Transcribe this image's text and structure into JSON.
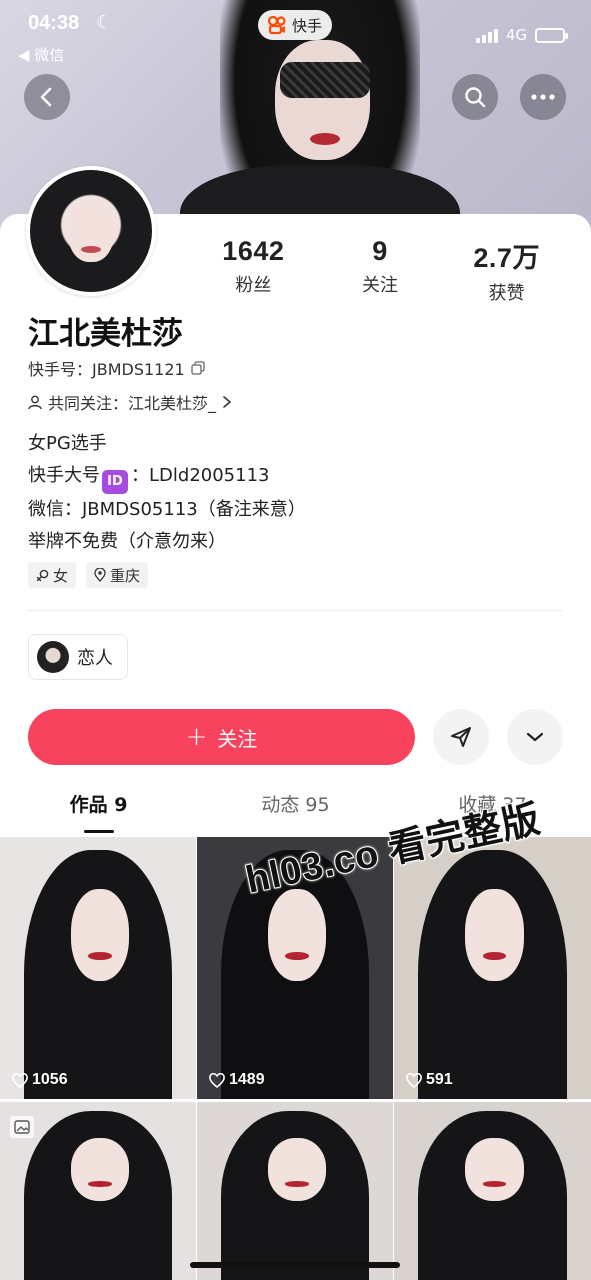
{
  "status_bar": {
    "time": "04:38",
    "back_app": "◀ 微信",
    "app_name": "快手",
    "network": "4G"
  },
  "profile": {
    "stats": [
      {
        "value": "1642",
        "label": "粉丝"
      },
      {
        "value": "9",
        "label": "关注"
      },
      {
        "value": "2.7万",
        "label": "获赞"
      }
    ],
    "name": "江北美杜莎",
    "kuaishou_id": "快手号：JBMDS1121",
    "mutual": "共同关注：江北美杜莎_",
    "bio": {
      "line1": "女PG选手",
      "line2_prefix": "快手大号",
      "line2_badge": "ID",
      "line2_suffix": "：LDld2005113",
      "line3": "微信：JBMDS05113（备注来意）",
      "line4": "举牌不免费（介意勿来）"
    },
    "tags": [
      {
        "icon": "female-icon",
        "label": "女"
      },
      {
        "icon": "location-pin-icon",
        "label": "重庆"
      }
    ],
    "relation_label": "恋人"
  },
  "actions": {
    "follow_label": "关注",
    "accent_color": "#f8435f"
  },
  "tabs": [
    {
      "label": "作品 9",
      "active": true
    },
    {
      "label": "动态 95",
      "active": false
    },
    {
      "label": "收藏 37",
      "active": false
    }
  ],
  "posts": [
    {
      "likes": "1056"
    },
    {
      "likes": "1489"
    },
    {
      "likes": "591"
    },
    {
      "likes": ""
    },
    {
      "likes": ""
    },
    {
      "likes": ""
    }
  ],
  "watermark": "hl03.co 看完整版"
}
